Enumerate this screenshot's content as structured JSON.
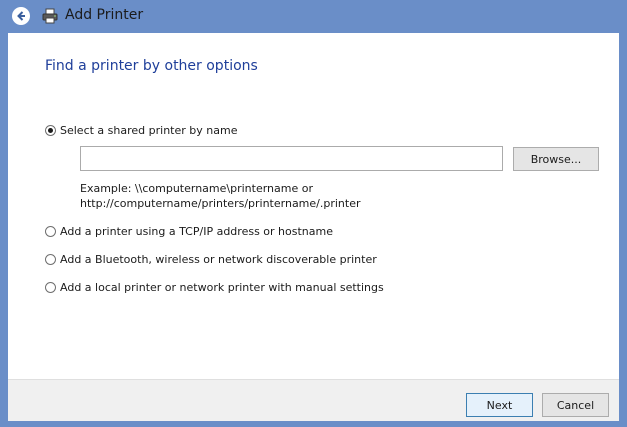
{
  "window": {
    "title": "Add Printer",
    "back_icon": "back-arrow-icon",
    "app_icon": "printer-icon"
  },
  "main": {
    "heading": "Find a printer by other options",
    "options": [
      {
        "label": "Select a shared printer by name",
        "selected": true
      },
      {
        "label": "Add a printer using a TCP/IP address or hostname",
        "selected": false
      },
      {
        "label": "Add a Bluetooth, wireless or network discoverable printer",
        "selected": false
      },
      {
        "label": "Add a local printer or network printer with manual settings",
        "selected": false
      }
    ],
    "shared_printer_input": {
      "value": "",
      "placeholder": ""
    },
    "browse_label": "Browse...",
    "example_line1": "Example: \\\\computername\\printername or",
    "example_line2": "http://computername/printers/printername/.printer"
  },
  "footer": {
    "next_label": "Next",
    "cancel_label": "Cancel"
  },
  "colors": {
    "frame": "#6a8ec8",
    "heading": "#1f3f9a",
    "button_focus_border": "#3c7fb1"
  }
}
